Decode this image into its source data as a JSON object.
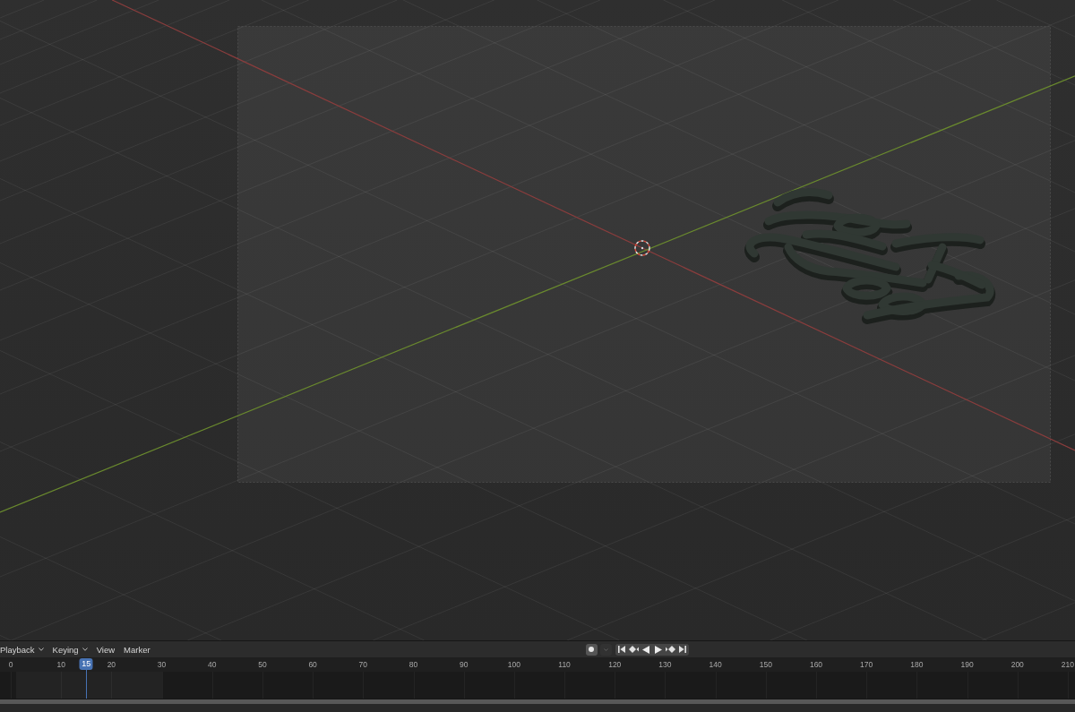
{
  "timeline": {
    "menus": [
      {
        "label": "Playback",
        "dropdown": true
      },
      {
        "label": "Keying",
        "dropdown": true
      },
      {
        "label": "View",
        "dropdown": false
      },
      {
        "label": "Marker",
        "dropdown": false
      }
    ],
    "ruler": {
      "ticks": [
        "0",
        "10",
        "20",
        "30",
        "40",
        "50",
        "60",
        "70",
        "80",
        "90",
        "100",
        "110",
        "120",
        "130",
        "140",
        "150",
        "160",
        "170",
        "180",
        "190",
        "200",
        "210"
      ]
    },
    "playhead": {
      "frame": "15",
      "level": 0.0802
    }
  }
}
